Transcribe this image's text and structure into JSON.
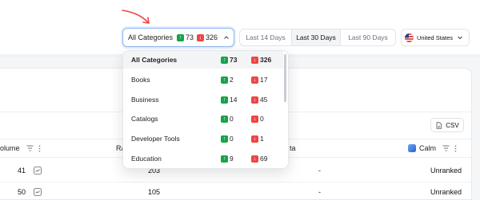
{
  "category_filter": {
    "label": "All Categories",
    "up_count": "73",
    "down_count": "326"
  },
  "date_range": {
    "options": [
      "Last 14 Days",
      "Last 30 Days",
      "Last 90 Days"
    ],
    "selected": "Last 30 Days"
  },
  "country": {
    "label": "United States",
    "flag_icon": "us-flag-icon"
  },
  "export": {
    "label": "CSV"
  },
  "table": {
    "columns": {
      "volume": "olume",
      "rank": "Ra",
      "delta": "ta",
      "calm": "Calm"
    },
    "rows": [
      {
        "volume": "41",
        "rank": "203",
        "delta": "-",
        "calm": "Unranked"
      },
      {
        "volume": "50",
        "rank": "105",
        "delta": "-",
        "calm": "Unranked"
      }
    ]
  },
  "dropdown": {
    "items": [
      {
        "name": "All Categories",
        "up": "73",
        "down": "326"
      },
      {
        "name": "Books",
        "up": "2",
        "down": "17"
      },
      {
        "name": "Business",
        "up": "14",
        "down": "45"
      },
      {
        "name": "Catalogs",
        "up": "0",
        "down": "0"
      },
      {
        "name": "Developer Tools",
        "up": "0",
        "down": "1"
      },
      {
        "name": "Education",
        "up": "9",
        "down": "69"
      }
    ]
  },
  "colors": {
    "accent_border": "#8fb7ee",
    "up_badge": "#16a34a",
    "down_badge": "#ef4444",
    "arrow": "#ef4444"
  }
}
